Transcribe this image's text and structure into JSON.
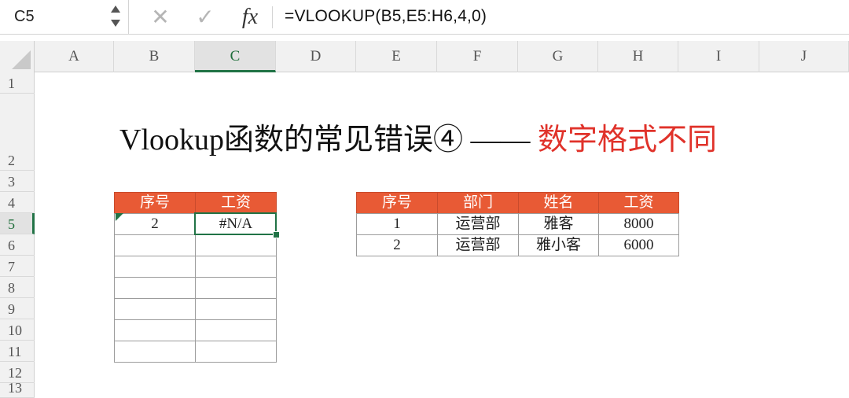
{
  "formula_bar": {
    "name_box": "C5",
    "cancel_icon": "✕",
    "enter_icon": "✓",
    "fx_label": "fx",
    "formula": "=VLOOKUP(B5,E5:H6,4,0)"
  },
  "columns": [
    "A",
    "B",
    "C",
    "D",
    "E",
    "F",
    "G",
    "H",
    "I",
    "J"
  ],
  "rows": [
    "1",
    "2",
    "3",
    "4",
    "5",
    "6",
    "7",
    "8",
    "9",
    "10",
    "11",
    "12",
    "13"
  ],
  "selected": {
    "column": "C",
    "row": "5"
  },
  "title": {
    "main": "Vlookup函数的常见错误④ —— ",
    "highlight": "数字格式不同"
  },
  "left_table": {
    "headers": [
      "序号",
      "工资"
    ],
    "rows": [
      [
        "2",
        "#N/A"
      ],
      [
        "",
        ""
      ],
      [
        "",
        ""
      ],
      [
        "",
        ""
      ],
      [
        "",
        ""
      ],
      [
        "",
        ""
      ],
      [
        "",
        ""
      ]
    ]
  },
  "right_table": {
    "headers": [
      "序号",
      "部门",
      "姓名",
      "工资"
    ],
    "rows": [
      [
        "1",
        "运营部",
        "雅客",
        "8000"
      ],
      [
        "2",
        "运营部",
        "雅小客",
        "6000"
      ]
    ]
  },
  "colors": {
    "header_fill": "#e85a35",
    "selection_green": "#217346",
    "title_highlight": "#e0322a"
  }
}
